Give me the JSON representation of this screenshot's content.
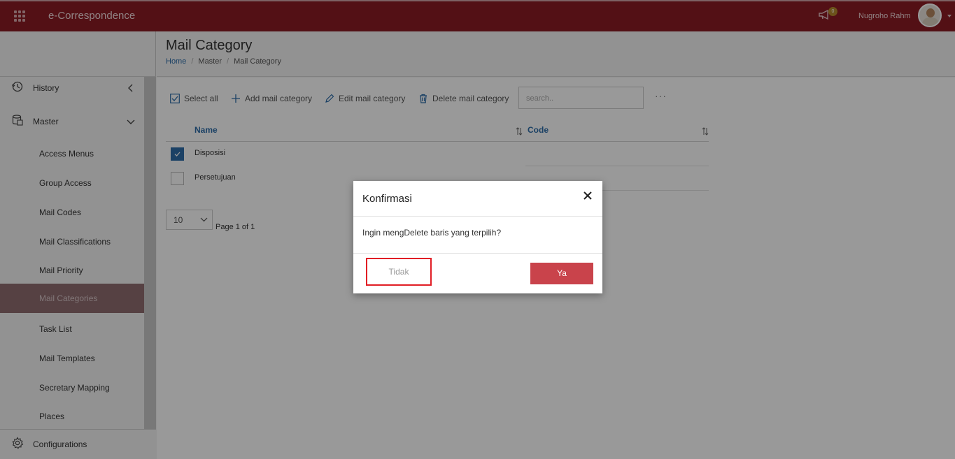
{
  "app": {
    "title": "e-Correspondence"
  },
  "header": {
    "notification_count": "0",
    "username": "Nugroho Rahm"
  },
  "sidebar": {
    "history": "History",
    "master": "Master",
    "items": [
      "Access Menus",
      "Group Access",
      "Mail Codes",
      "Mail Classifications",
      "Mail Priority",
      "Mail Categories",
      "Task List",
      "Mail Templates",
      "Secretary Mapping",
      "Places"
    ],
    "active_item": "Mail Categories",
    "configurations": "Configurations"
  },
  "page": {
    "title": "Mail Category",
    "breadcrumb": [
      "Home",
      "Master",
      "Mail Category"
    ]
  },
  "toolbar": {
    "select_all": "Select all",
    "add": "Add mail category",
    "edit": "Edit mail category",
    "delete": "Delete mail category",
    "search_placeholder": "search..",
    "more": "···"
  },
  "table": {
    "columns": [
      "Name",
      "Code"
    ],
    "rows": [
      {
        "name": "Disposisi",
        "code": "",
        "checked": true
      },
      {
        "name": "Persetujuan",
        "code": "",
        "checked": false
      }
    ]
  },
  "pager": {
    "page_size": "10",
    "page_text": "Page 1 of 1"
  },
  "dialog": {
    "title": "Konfirmasi",
    "message": "Ingin mengDelete baris yang terpilih?",
    "cancel": "Tidak",
    "confirm": "Ya"
  },
  "colors": {
    "topbar": "#8a1c24",
    "accent": "#2d6da8",
    "confirm_button": "#c9434b",
    "highlight_box": "#e11e25"
  }
}
